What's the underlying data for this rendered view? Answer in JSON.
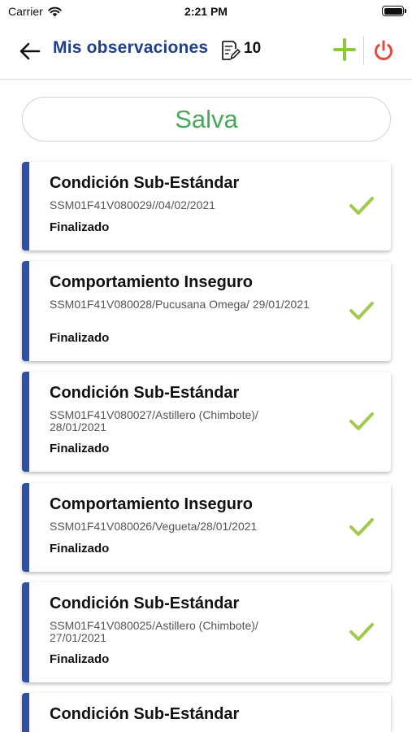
{
  "status_bar": {
    "carrier": "Carrier",
    "time": "2:21 PM"
  },
  "nav": {
    "title": "Mis observaciones",
    "count": "10"
  },
  "filter": {
    "label": "Salva",
    "color": "#47a85c"
  },
  "colors": {
    "accent_blue": "#2f51a5",
    "title_blue": "#1f3f8a",
    "add_green": "#8dc63f",
    "power_red": "#e24b3f",
    "check_green": "#a3c94a"
  },
  "observations": [
    {
      "title": "Condición Sub-Estándar",
      "code": "SSM01F41V080029//04/02/2021",
      "status": "Finalizado"
    },
    {
      "title": "Comportamiento Inseguro",
      "code": "SSM01F41V080028/Pucusana Omega/ 29/01/2021",
      "status": "Finalizado"
    },
    {
      "title": "Condición Sub-Estándar",
      "code": "SSM01F41V080027/Astillero (Chimbote)/ 28/01/2021",
      "status": "Finalizado"
    },
    {
      "title": "Comportamiento Inseguro",
      "code": "SSM01F41V080026/Vegueta/28/01/2021",
      "status": "Finalizado"
    },
    {
      "title": "Condición Sub-Estándar",
      "code": "SSM01F41V080025/Astillero (Chimbote)/ 27/01/2021",
      "status": "Finalizado"
    },
    {
      "title": "Condición Sub-Estándar"
    }
  ]
}
